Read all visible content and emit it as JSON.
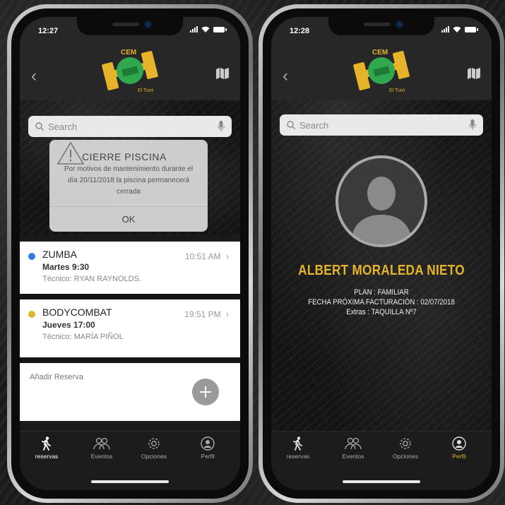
{
  "colors": {
    "accent": "#e5b42a",
    "blue_dot": "#2e7ce6",
    "yellow_dot": "#e5b42a"
  },
  "logo": {
    "top_text": "CEM",
    "bottom_text": "El Turó"
  },
  "phone1": {
    "status": {
      "time": "12:27"
    },
    "search": {
      "placeholder": "Search",
      "icon": "search-icon",
      "mic_icon": "microphone-icon"
    },
    "alert": {
      "title": "CIERRE PISCINA",
      "body_line1": "Por motivos de mantenimiento durante el",
      "body_line2": "día 20/11/2018 la piscina permanecerá",
      "body_line3": "cerrada",
      "ok": "OK"
    },
    "reservations": [
      {
        "name": "ZUMBA",
        "day": "Martes 9:30",
        "tech": "Técnico: RYAN RAYNOLDS.",
        "time": "10:51 AM",
        "dot": "blue"
      },
      {
        "name": "BODYCOMBAT",
        "day": "Jueves 17:00",
        "tech": "Técnico: MARÍA PIÑOL",
        "time": "19:51 PM",
        "dot": "yellow"
      }
    ],
    "add": {
      "label": "Añadir Reserva",
      "icon": "plus-icon"
    },
    "tabs": [
      {
        "label": "reservas",
        "icon": "walking-person-icon",
        "active": true
      },
      {
        "label": "Eventos",
        "icon": "people-icon",
        "active": false
      },
      {
        "label": "Opciones",
        "icon": "gear-icon",
        "active": false
      },
      {
        "label": "Perfil",
        "icon": "profile-icon",
        "active": false
      }
    ]
  },
  "phone2": {
    "status": {
      "time": "12:28"
    },
    "search": {
      "placeholder": "Search"
    },
    "profile": {
      "name": "ALBERT MORALEDA NIETO",
      "plan": "PLAN : FAMILIAR",
      "billing": "FECHA PRÓXIMA FACTURACIÓN : 02/07/2018",
      "extras": "Extras : TAQUILLA Nº7"
    },
    "tabs": [
      {
        "label": "reservas",
        "icon": "walking-person-icon",
        "active": false
      },
      {
        "label": "Eventos",
        "icon": "people-icon",
        "active": false
      },
      {
        "label": "Opciones",
        "icon": "gear-icon",
        "active": false
      },
      {
        "label": "Perfil",
        "icon": "profile-icon",
        "active": true
      }
    ]
  }
}
